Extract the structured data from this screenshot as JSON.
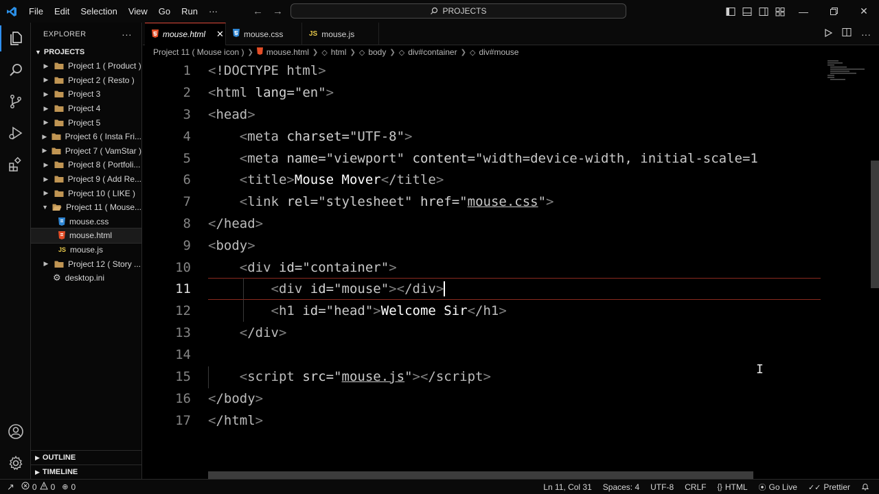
{
  "titlebar": {
    "menu": [
      "File",
      "Edit",
      "Selection",
      "View",
      "Go",
      "Run",
      "···"
    ],
    "search_text": "PROJECTS"
  },
  "sidebar": {
    "header": "EXPLORER",
    "section": "PROJECTS",
    "items": [
      {
        "label": "Project 1 ( Product )",
        "kind": "folder",
        "depth": 0
      },
      {
        "label": "Project 2 ( Resto )",
        "kind": "folder",
        "depth": 0
      },
      {
        "label": "Project 3",
        "kind": "folder",
        "depth": 0
      },
      {
        "label": "Project 4",
        "kind": "folder",
        "depth": 0
      },
      {
        "label": "Project 5",
        "kind": "folder",
        "depth": 0
      },
      {
        "label": "Project 6 ( Insta Fri...",
        "kind": "folder",
        "depth": 0
      },
      {
        "label": "Project 7 ( VamStar )",
        "kind": "folder",
        "depth": 0
      },
      {
        "label": "Project 8 ( Portfoli...",
        "kind": "folder",
        "depth": 0
      },
      {
        "label": "Project 9 ( Add  Re...",
        "kind": "folder",
        "depth": 0
      },
      {
        "label": "Project 10 ( LIKE )",
        "kind": "folder",
        "depth": 0
      },
      {
        "label": "Project 11 ( Mouse...",
        "kind": "folder-open",
        "depth": 0
      },
      {
        "label": "mouse.css",
        "kind": "css",
        "depth": 1
      },
      {
        "label": "mouse.html",
        "kind": "html",
        "depth": 1
      },
      {
        "label": "mouse.js",
        "kind": "js",
        "depth": 1
      },
      {
        "label": "Project 12 ( Story ...",
        "kind": "folder",
        "depth": 0
      },
      {
        "label": "desktop.ini",
        "kind": "gear",
        "depth": 0
      }
    ],
    "outline": "OUTLINE",
    "timeline": "TIMELINE"
  },
  "tabs": [
    {
      "label": "mouse.html",
      "kind": "html"
    },
    {
      "label": "mouse.css",
      "kind": "css"
    },
    {
      "label": "mouse.js",
      "kind": "js"
    }
  ],
  "breadcrumb": [
    "Project 11 ( Mouse icon )",
    "mouse.html",
    "html",
    "body",
    "div#container",
    "div#mouse"
  ],
  "editor": {
    "line_numbers": [
      "1",
      "2",
      "3",
      "4",
      "5",
      "6",
      "7",
      "8",
      "9",
      "10",
      "11",
      "12",
      "13",
      "14",
      "15",
      "16",
      "17"
    ],
    "current_line": "11",
    "code": {
      "l1_decl": "!DOCTYPE",
      "l1_html": "html",
      "l2_tag": "html",
      "l2_attr": "lang",
      "l2_val": "\"en\"",
      "l3_tag": "head",
      "l4_tag": "meta",
      "l4_attr": "charset",
      "l4_val": "\"UTF-8\"",
      "l5_tag": "meta",
      "l5_attr1": "name",
      "l5_val1": "\"viewport\"",
      "l5_attr2": "content",
      "l5_val2": "\"width=device-width, initial-scale=1",
      "l6_tag": "title",
      "l6_text": "Mouse Mover",
      "l6_close": "/title",
      "l7_tag": "link",
      "l7_attr1": "rel",
      "l7_val1": "\"stylesheet\"",
      "l7_attr2": "href",
      "l7_val2_q": "\"",
      "l7_val2": "mouse.css",
      "l7_val2_q2": "\"",
      "l8_tag": "/head",
      "l9_tag": "body",
      "l10_tag": "div",
      "l10_attr": "id",
      "l10_val": "\"container\"",
      "l11_tag": "div",
      "l11_attr": "id",
      "l11_val": "\"mouse\"",
      "l11_close": "/div",
      "l12_tag": "h1",
      "l12_attr": "id",
      "l12_val": "\"head\"",
      "l12_text": "Welcome Sir",
      "l12_close": "/h1",
      "l13_tag": "/div",
      "l15_tag": "script",
      "l15_attr": "src",
      "l15_val_q": "\"",
      "l15_val": "mouse.js",
      "l15_val_q2": "\"",
      "l15_close": "/script",
      "l16_tag": "/body",
      "l17_tag": "/html"
    }
  },
  "statusbar": {
    "errors": "0",
    "warnings": "0",
    "ports": "0",
    "position": "Ln 11, Col 31",
    "spaces": "Spaces: 4",
    "encoding": "UTF-8",
    "eol": "CRLF",
    "language": "HTML",
    "golive": "Go Live",
    "prettier": "Prettier"
  }
}
